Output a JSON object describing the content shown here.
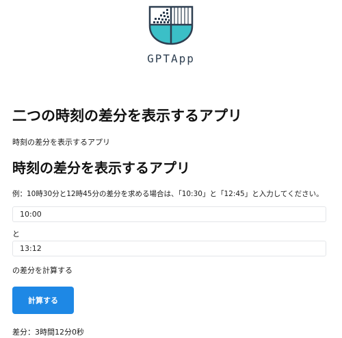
{
  "logo": {
    "icon": "gptapp-shield-logo-icon",
    "app_name": "GPTApp",
    "colors": {
      "outline": "#2d3e50",
      "teal": "#3bbfc7",
      "square": "#2d3e50"
    }
  },
  "header": {
    "title": "二つの時刻の差分を表示するアプリ",
    "subtitle": "時刻の差分を表示するアプリ"
  },
  "main": {
    "section_title": "時刻の差分を表示するアプリ",
    "example": "例：10時30分と12時45分の差分を求める場合は、「10:30」と「12:45」と入力してください。",
    "start_time": {
      "value": "10:00"
    },
    "connector": "と",
    "end_time": {
      "value": "13:12"
    },
    "calc_label": "の差分を計算する",
    "calc_button_label": "計算する",
    "result": "差分：3時間12分0秒"
  },
  "colors": {
    "button": "#1e88e5",
    "field_border": "#e3e5e8"
  }
}
